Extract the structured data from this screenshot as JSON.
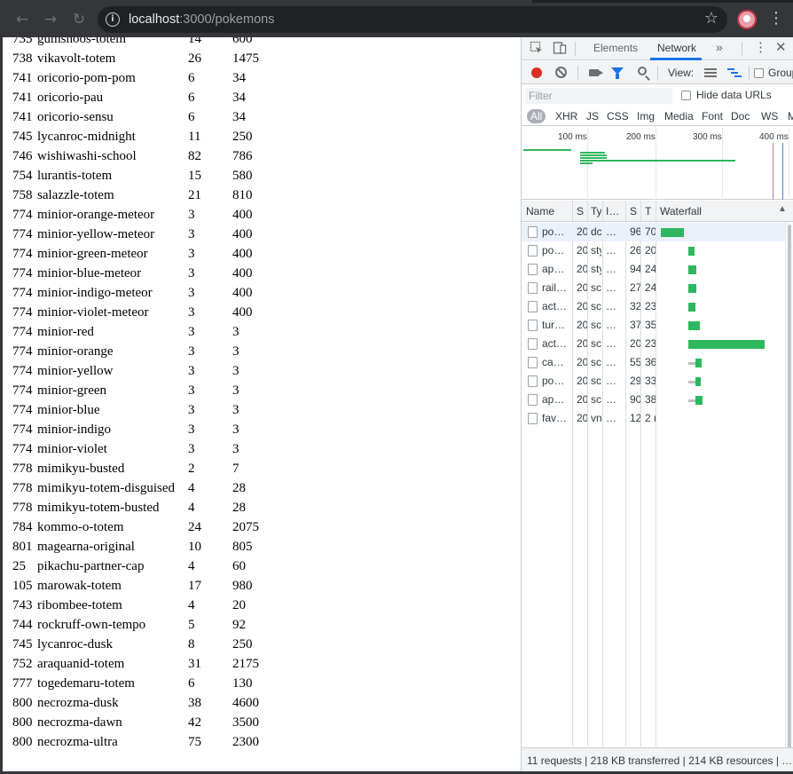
{
  "browser": {
    "url_host": "localhost",
    "url_rest": ":3000/pokemons",
    "back_icon": "arrow-left-icon",
    "forward_icon": "arrow-right-icon",
    "reload_icon": "reload-icon",
    "info_icon": "info-icon",
    "bookmark_icon": "star-icon",
    "menu_icon": "kebab-menu-icon"
  },
  "pokemon_rows": [
    {
      "id": "735",
      "name": "gumshoos-totem",
      "height": "14",
      "weight": "600"
    },
    {
      "id": "738",
      "name": "vikavolt-totem",
      "height": "26",
      "weight": "1475"
    },
    {
      "id": "741",
      "name": "oricorio-pom-pom",
      "height": "6",
      "weight": "34"
    },
    {
      "id": "741",
      "name": "oricorio-pau",
      "height": "6",
      "weight": "34"
    },
    {
      "id": "741",
      "name": "oricorio-sensu",
      "height": "6",
      "weight": "34"
    },
    {
      "id": "745",
      "name": "lycanroc-midnight",
      "height": "11",
      "weight": "250"
    },
    {
      "id": "746",
      "name": "wishiwashi-school",
      "height": "82",
      "weight": "786"
    },
    {
      "id": "754",
      "name": "lurantis-totem",
      "height": "15",
      "weight": "580"
    },
    {
      "id": "758",
      "name": "salazzle-totem",
      "height": "21",
      "weight": "810"
    },
    {
      "id": "774",
      "name": "minior-orange-meteor",
      "height": "3",
      "weight": "400"
    },
    {
      "id": "774",
      "name": "minior-yellow-meteor",
      "height": "3",
      "weight": "400"
    },
    {
      "id": "774",
      "name": "minior-green-meteor",
      "height": "3",
      "weight": "400"
    },
    {
      "id": "774",
      "name": "minior-blue-meteor",
      "height": "3",
      "weight": "400"
    },
    {
      "id": "774",
      "name": "minior-indigo-meteor",
      "height": "3",
      "weight": "400"
    },
    {
      "id": "774",
      "name": "minior-violet-meteor",
      "height": "3",
      "weight": "400"
    },
    {
      "id": "774",
      "name": "minior-red",
      "height": "3",
      "weight": "3"
    },
    {
      "id": "774",
      "name": "minior-orange",
      "height": "3",
      "weight": "3"
    },
    {
      "id": "774",
      "name": "minior-yellow",
      "height": "3",
      "weight": "3"
    },
    {
      "id": "774",
      "name": "minior-green",
      "height": "3",
      "weight": "3"
    },
    {
      "id": "774",
      "name": "minior-blue",
      "height": "3",
      "weight": "3"
    },
    {
      "id": "774",
      "name": "minior-indigo",
      "height": "3",
      "weight": "3"
    },
    {
      "id": "774",
      "name": "minior-violet",
      "height": "3",
      "weight": "3"
    },
    {
      "id": "778",
      "name": "mimikyu-busted",
      "height": "2",
      "weight": "7"
    },
    {
      "id": "778",
      "name": "mimikyu-totem-disguised",
      "height": "4",
      "weight": "28"
    },
    {
      "id": "778",
      "name": "mimikyu-totem-busted",
      "height": "4",
      "weight": "28"
    },
    {
      "id": "784",
      "name": "kommo-o-totem",
      "height": "24",
      "weight": "2075"
    },
    {
      "id": "801",
      "name": "magearna-original",
      "height": "10",
      "weight": "805"
    },
    {
      "id": "25",
      "name": "pikachu-partner-cap",
      "height": "4",
      "weight": "60"
    },
    {
      "id": "105",
      "name": "marowak-totem",
      "height": "17",
      "weight": "980"
    },
    {
      "id": "743",
      "name": "ribombee-totem",
      "height": "4",
      "weight": "20"
    },
    {
      "id": "744",
      "name": "rockruff-own-tempo",
      "height": "5",
      "weight": "92"
    },
    {
      "id": "745",
      "name": "lycanroc-dusk",
      "height": "8",
      "weight": "250"
    },
    {
      "id": "752",
      "name": "araquanid-totem",
      "height": "31",
      "weight": "2175"
    },
    {
      "id": "777",
      "name": "togedemaru-totem",
      "height": "6",
      "weight": "130"
    },
    {
      "id": "800",
      "name": "necrozma-dusk",
      "height": "38",
      "weight": "4600"
    },
    {
      "id": "800",
      "name": "necrozma-dawn",
      "height": "42",
      "weight": "3500"
    },
    {
      "id": "800",
      "name": "necrozma-ultra",
      "height": "75",
      "weight": "2300"
    }
  ],
  "devtools": {
    "tabs": {
      "elements": "Elements",
      "network": "Network",
      "more": "»"
    },
    "toolbar": {
      "view_label": "View:",
      "group_label": "Group"
    },
    "filter": {
      "placeholder": "Filter",
      "hide_data_urls": "Hide data URLs"
    },
    "types": [
      "All",
      "XHR",
      "JS",
      "CSS",
      "Img",
      "Media",
      "Font",
      "Doc",
      "WS",
      "Ma"
    ],
    "overview_ticks": [
      "100 ms",
      "200 ms",
      "300 ms",
      "400 ms"
    ],
    "columns": {
      "name": "Name",
      "status": "S",
      "type": "Ty",
      "initiator": "I…",
      "size": "S",
      "time": "T",
      "waterfall": "Waterfall"
    },
    "requests": [
      {
        "name": "po…",
        "status": "20",
        "type": "dc",
        "initiator": "…",
        "size": "96",
        "time": "70",
        "wait": 0,
        "start": 0,
        "dur": 26
      },
      {
        "name": "po…",
        "status": "20",
        "type": "sty",
        "initiator": "…",
        "size": "26",
        "time": "20",
        "wait": 0,
        "start": 31,
        "dur": 7
      },
      {
        "name": "ap…",
        "status": "20",
        "type": "sty",
        "initiator": "…",
        "size": "94",
        "time": "24",
        "wait": 0,
        "start": 31,
        "dur": 9
      },
      {
        "name": "rail…",
        "status": "20",
        "type": "sc",
        "initiator": "…",
        "size": "27",
        "time": "24",
        "wait": 0,
        "start": 31,
        "dur": 9
      },
      {
        "name": "act…",
        "status": "20",
        "type": "sc",
        "initiator": "…",
        "size": "32",
        "time": "23",
        "wait": 0,
        "start": 31,
        "dur": 8
      },
      {
        "name": "tur…",
        "status": "20",
        "type": "sc",
        "initiator": "…",
        "size": "37",
        "time": "35",
        "wait": 0,
        "start": 31,
        "dur": 13
      },
      {
        "name": "act…",
        "status": "20",
        "type": "sc",
        "initiator": "…",
        "size": "20",
        "time": "23",
        "wait": 0,
        "start": 31,
        "dur": 86
      },
      {
        "name": "ca…",
        "status": "20",
        "type": "sc",
        "initiator": "…",
        "size": "55",
        "time": "36",
        "wait": 8,
        "start": 31,
        "dur": 7
      },
      {
        "name": "po…",
        "status": "20",
        "type": "sc",
        "initiator": "…",
        "size": "29",
        "time": "33",
        "wait": 8,
        "start": 31,
        "dur": 6
      },
      {
        "name": "ap…",
        "status": "20",
        "type": "sc",
        "initiator": "…",
        "size": "90",
        "time": "38",
        "wait": 8,
        "start": 31,
        "dur": 8
      },
      {
        "name": "fav…",
        "status": "20",
        "type": "vn",
        "initiator": "…",
        "size": "12",
        "time": "2 r",
        "wait": 0,
        "start": 0,
        "dur": 0
      }
    ],
    "status_text": "11 requests | 218 KB transferred | 214 KB resources | …",
    "colors": {
      "accent": "#1a73e8",
      "bar": "#2eb75f",
      "record": "#d93025"
    }
  }
}
